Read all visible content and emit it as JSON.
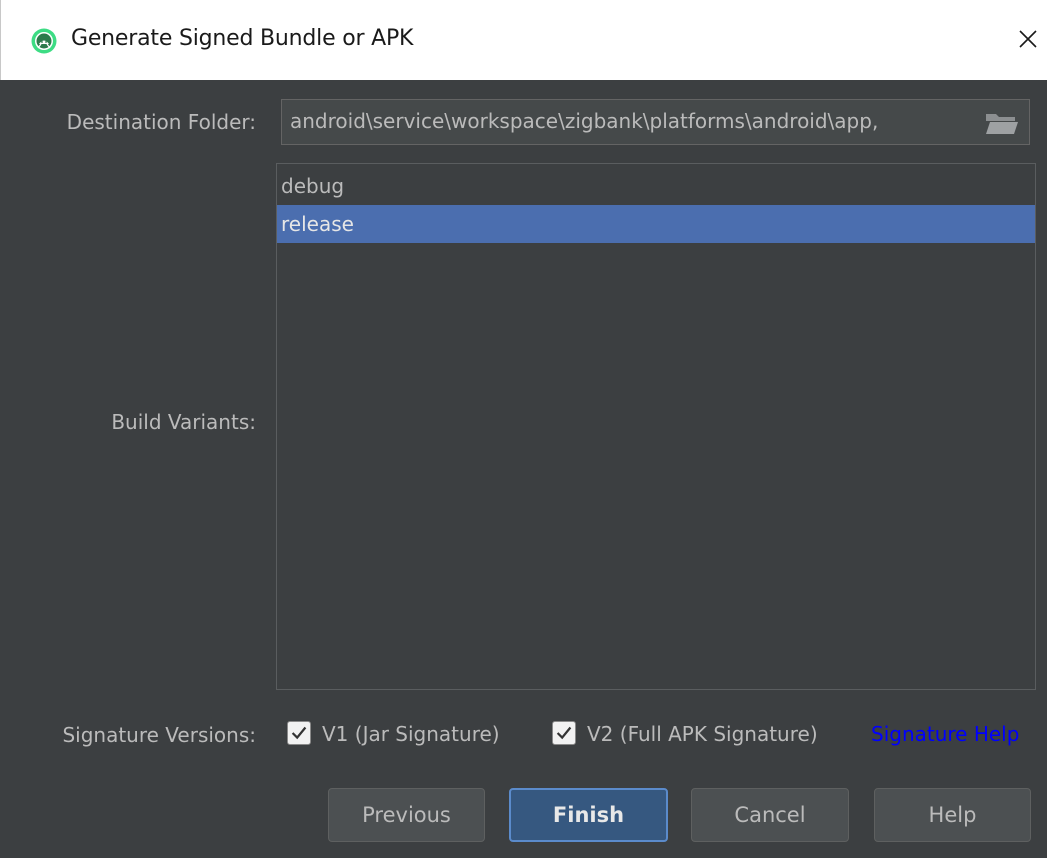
{
  "dialog": {
    "title": "Generate Signed Bundle or APK",
    "icon": "android-studio-icon",
    "close_icon": "close-icon"
  },
  "destination": {
    "label": "Destination Folder:",
    "value": ",android\\service\\workspace\\zigbank\\platforms\\android\\app",
    "browse_icon": "folder-icon"
  },
  "build_variants": {
    "label": "Build Variants:",
    "items": [
      {
        "label": "debug",
        "selected": false
      },
      {
        "label": "release",
        "selected": true
      }
    ]
  },
  "signature": {
    "label": "Signature Versions:",
    "v1": {
      "label": "V1 (Jar Signature)",
      "checked": true
    },
    "v2": {
      "label": "V2 (Full APK Signature)",
      "checked": true
    },
    "help_link": "Signature Help"
  },
  "buttons": {
    "previous": "Previous",
    "finish": "Finish",
    "cancel": "Cancel",
    "help": "Help"
  },
  "colors": {
    "background": "#3c3f41",
    "selection": "#4b6eaf",
    "link": "#0000ff",
    "default_button": "#365880"
  }
}
